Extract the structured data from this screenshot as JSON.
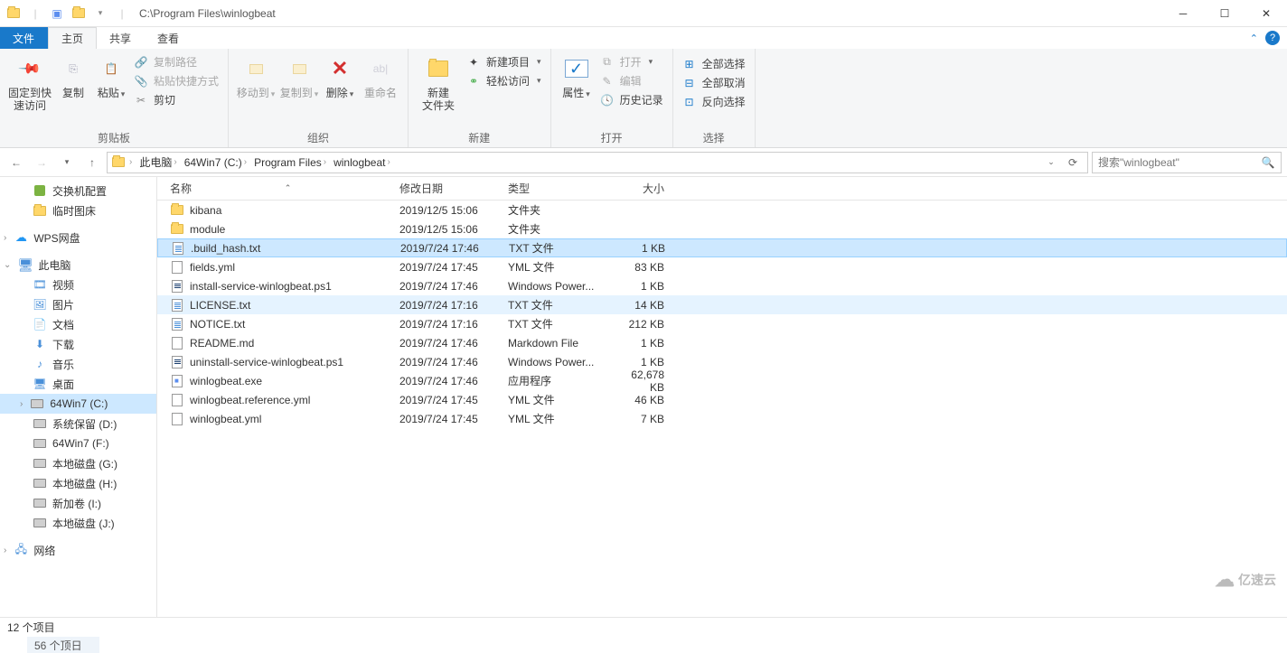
{
  "title": "C:\\Program Files\\winlogbeat",
  "tabs": {
    "file": "文件",
    "home": "主页",
    "share": "共享",
    "view": "查看"
  },
  "ribbon": {
    "clipboard": {
      "pin": "固定到快\n速访问",
      "copy": "复制",
      "paste": "粘贴",
      "copy_path": "复制路径",
      "paste_shortcut": "粘贴快捷方式",
      "cut": "剪切",
      "label": "剪贴板"
    },
    "organize": {
      "move_to": "移动到",
      "copy_to": "复制到",
      "delete": "删除",
      "rename": "重命名",
      "label": "组织"
    },
    "new": {
      "new_folder": "新建\n文件夹",
      "new_item": "新建项目",
      "easy_access": "轻松访问",
      "label": "新建"
    },
    "open": {
      "properties": "属性",
      "open": "打开",
      "edit": "编辑",
      "history": "历史记录",
      "label": "打开"
    },
    "select": {
      "select_all": "全部选择",
      "select_none": "全部取消",
      "invert": "反向选择",
      "label": "选择"
    }
  },
  "breadcrumbs": [
    "此电脑",
    "64Win7  (C:)",
    "Program Files",
    "winlogbeat"
  ],
  "search_placeholder": "搜索\"winlogbeat\"",
  "columns": {
    "name": "名称",
    "date": "修改日期",
    "type": "类型",
    "size": "大小"
  },
  "tree": {
    "quick": [
      {
        "icon": "green",
        "label": "交换机配置"
      },
      {
        "icon": "folder",
        "label": "临时图床"
      }
    ],
    "wps": "WPS网盘",
    "pc": "此电脑",
    "pc_items": [
      {
        "icon": "video",
        "label": "视频"
      },
      {
        "icon": "image",
        "label": "图片"
      },
      {
        "icon": "doc",
        "label": "文档"
      },
      {
        "icon": "dl",
        "label": "下载"
      },
      {
        "icon": "music",
        "label": "音乐"
      },
      {
        "icon": "desktop",
        "label": "桌面"
      },
      {
        "icon": "disk",
        "label": "64Win7  (C:)",
        "sel": true
      },
      {
        "icon": "disk",
        "label": "系统保留 (D:)"
      },
      {
        "icon": "disk",
        "label": "64Win7  (F:)"
      },
      {
        "icon": "disk",
        "label": "本地磁盘 (G:)"
      },
      {
        "icon": "disk",
        "label": "本地磁盘 (H:)"
      },
      {
        "icon": "disk",
        "label": "新加卷 (I:)"
      },
      {
        "icon": "disk",
        "label": "本地磁盘 (J:)"
      }
    ],
    "network": "网络"
  },
  "files": [
    {
      "icon": "folder",
      "name": "kibana",
      "date": "2019/12/5 15:06",
      "type": "文件夹",
      "size": ""
    },
    {
      "icon": "folder",
      "name": "module",
      "date": "2019/12/5 15:06",
      "type": "文件夹",
      "size": ""
    },
    {
      "icon": "txt",
      "name": ".build_hash.txt",
      "date": "2019/7/24 17:46",
      "type": "TXT 文件",
      "size": "1 KB",
      "sel": true
    },
    {
      "icon": "file",
      "name": "fields.yml",
      "date": "2019/7/24 17:45",
      "type": "YML 文件",
      "size": "83 KB"
    },
    {
      "icon": "ps1",
      "name": "install-service-winlogbeat.ps1",
      "date": "2019/7/24 17:46",
      "type": "Windows Power...",
      "size": "1 KB"
    },
    {
      "icon": "txt",
      "name": "LICENSE.txt",
      "date": "2019/7/24 17:16",
      "type": "TXT 文件",
      "size": "14 KB",
      "hov": true
    },
    {
      "icon": "txt",
      "name": "NOTICE.txt",
      "date": "2019/7/24 17:16",
      "type": "TXT 文件",
      "size": "212 KB"
    },
    {
      "icon": "file",
      "name": "README.md",
      "date": "2019/7/24 17:46",
      "type": "Markdown File",
      "size": "1 KB"
    },
    {
      "icon": "ps1",
      "name": "uninstall-service-winlogbeat.ps1",
      "date": "2019/7/24 17:46",
      "type": "Windows Power...",
      "size": "1 KB"
    },
    {
      "icon": "exe",
      "name": "winlogbeat.exe",
      "date": "2019/7/24 17:46",
      "type": "应用程序",
      "size": "62,678 KB"
    },
    {
      "icon": "file",
      "name": "winlogbeat.reference.yml",
      "date": "2019/7/24 17:45",
      "type": "YML 文件",
      "size": "46 KB"
    },
    {
      "icon": "file",
      "name": "winlogbeat.yml",
      "date": "2019/7/24 17:45",
      "type": "YML 文件",
      "size": "7 KB"
    }
  ],
  "status": "12 个项目",
  "status_extra": "56 个顶日",
  "watermark": "亿速云"
}
